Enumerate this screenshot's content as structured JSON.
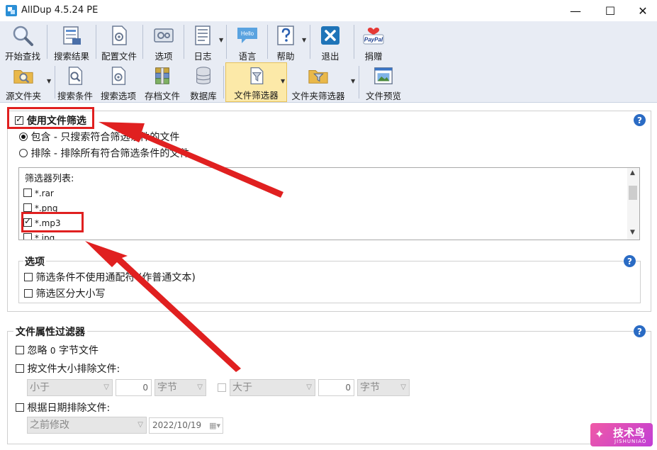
{
  "window": {
    "title": "AllDup 4.5.24 PE",
    "minimize_glyph": "—",
    "maximize_glyph": "☐",
    "close_glyph": "✕"
  },
  "toolbar_main": [
    {
      "id": "start-search",
      "label": "开始查找",
      "icon": "magnifier-icon"
    },
    {
      "id": "search-results",
      "label": "搜索结果",
      "icon": "results-icon"
    },
    {
      "id": "config-file",
      "label": "配置文件",
      "icon": "config-file-icon"
    },
    {
      "id": "options",
      "label": "选项",
      "icon": "options-icon"
    },
    {
      "id": "log",
      "label": "日志",
      "icon": "log-icon"
    },
    {
      "id": "language",
      "label": "语言",
      "icon": "hello-bubble-icon",
      "icon_text": "Hello"
    },
    {
      "id": "help",
      "label": "帮助",
      "icon": "help-icon"
    },
    {
      "id": "exit",
      "label": "退出",
      "icon": "exit-icon"
    },
    {
      "id": "donate",
      "label": "捐赠",
      "icon": "paypal-icon",
      "icon_text": "PayPal"
    }
  ],
  "toolbar_sections": [
    {
      "id": "source-folder",
      "label": "源文件夹",
      "icon": "folder-search-icon"
    },
    {
      "id": "search-criteria",
      "label": "搜索条件",
      "icon": "search-criteria-icon"
    },
    {
      "id": "search-options",
      "label": "搜索选项",
      "icon": "search-options-icon"
    },
    {
      "id": "archive-files",
      "label": "存档文件",
      "icon": "archive-icon"
    },
    {
      "id": "database",
      "label": "数据库",
      "icon": "database-icon"
    },
    {
      "id": "file-filter",
      "label": "文件筛选器",
      "icon": "file-filter-icon",
      "active": true
    },
    {
      "id": "folder-filter",
      "label": "文件夹筛选器",
      "icon": "folder-filter-icon"
    },
    {
      "id": "file-preview",
      "label": "文件预览",
      "icon": "preview-icon"
    }
  ],
  "file_filter": {
    "enable_label": "使用文件筛选",
    "enabled": true,
    "include_label": "包含 - 只搜索符合筛选条件的文件",
    "exclude_label": "排除 - 排除所有符合筛选条件的文件",
    "mode": "include",
    "list_header": "筛选器列表:",
    "items": [
      {
        "pattern": "*.rar",
        "checked": false
      },
      {
        "pattern": "*.png",
        "checked": false
      },
      {
        "pattern": "*.mp3",
        "checked": true
      },
      {
        "pattern": "*.jpg",
        "checked": false
      }
    ],
    "options_title": "选项",
    "no_wildcards_label": "筛选条件不使用通配符 (作普通文本)",
    "case_sensitive_label": "筛选区分大小写"
  },
  "attr_filter": {
    "title": "文件属性过滤器",
    "ignore_zero_label_prefix": "忽略",
    "ignore_zero_value": "0",
    "ignore_zero_label_suffix": "字节文件",
    "exclude_by_size_label": "按文件大小排除文件:",
    "size_less_op": "小于",
    "size_less_value": "0",
    "size_less_unit": "字节",
    "size_greater_op": "大于",
    "size_greater_value": "0",
    "size_greater_unit": "字节",
    "exclude_by_date_label": "根据日期排除文件:",
    "date_mode": "之前修改",
    "date_value": "2022/10/19"
  },
  "watermark": {
    "logo_glyph": "✦",
    "cn": "技术鸟",
    "en": "JISHUNIAO"
  },
  "colors": {
    "toolbar_bg": "#e8ecf4",
    "active_tab_bg": "#fce9a8",
    "help_blue": "#2a6bc4",
    "annotation_red": "#e02020",
    "watermark_pink": "#f05aa6"
  }
}
